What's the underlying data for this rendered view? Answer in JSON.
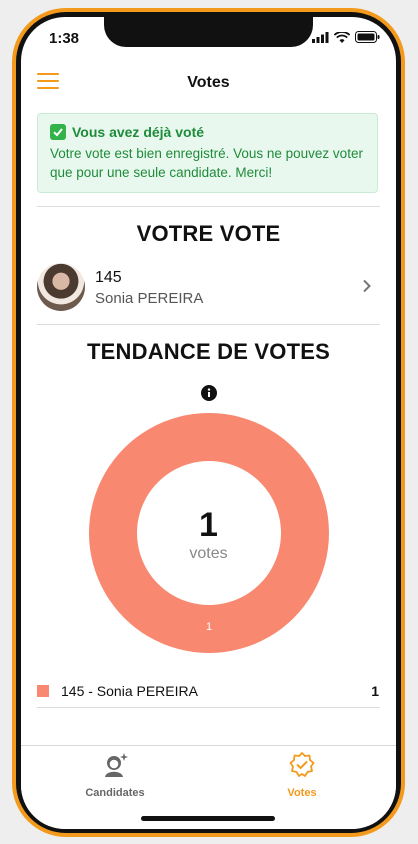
{
  "status": {
    "time": "1:38"
  },
  "header": {
    "title": "Votes"
  },
  "alert": {
    "title": "Vous avez déjà voté",
    "message": "Votre vote est bien enregistré. Vous ne pouvez voter que pour une seule candidate. Merci!"
  },
  "your_vote": {
    "heading": "VOTRE VOTE",
    "number": "145",
    "name": "Sonia PEREIRA"
  },
  "trend": {
    "heading": "TENDANCE DE VOTES",
    "total": "1",
    "total_label": "votes",
    "slice_label": "1"
  },
  "chart_data": {
    "type": "pie",
    "categories": [
      "145 - Sonia PEREIRA"
    ],
    "values": [
      1
    ],
    "colors": [
      "#f98871"
    ],
    "center_total": 1,
    "center_label": "votes"
  },
  "legend": [
    {
      "label": "145 - Sonia PEREIRA",
      "count": "1",
      "color": "#f98871"
    }
  ],
  "tabs": [
    {
      "label": "Candidates",
      "icon": "candidate-icon",
      "active": false
    },
    {
      "label": "Votes",
      "icon": "votes-badge-icon",
      "active": true
    }
  ],
  "colors": {
    "accent": "#f39a1c",
    "success": "#1e8c3a",
    "slice": "#f98871"
  }
}
